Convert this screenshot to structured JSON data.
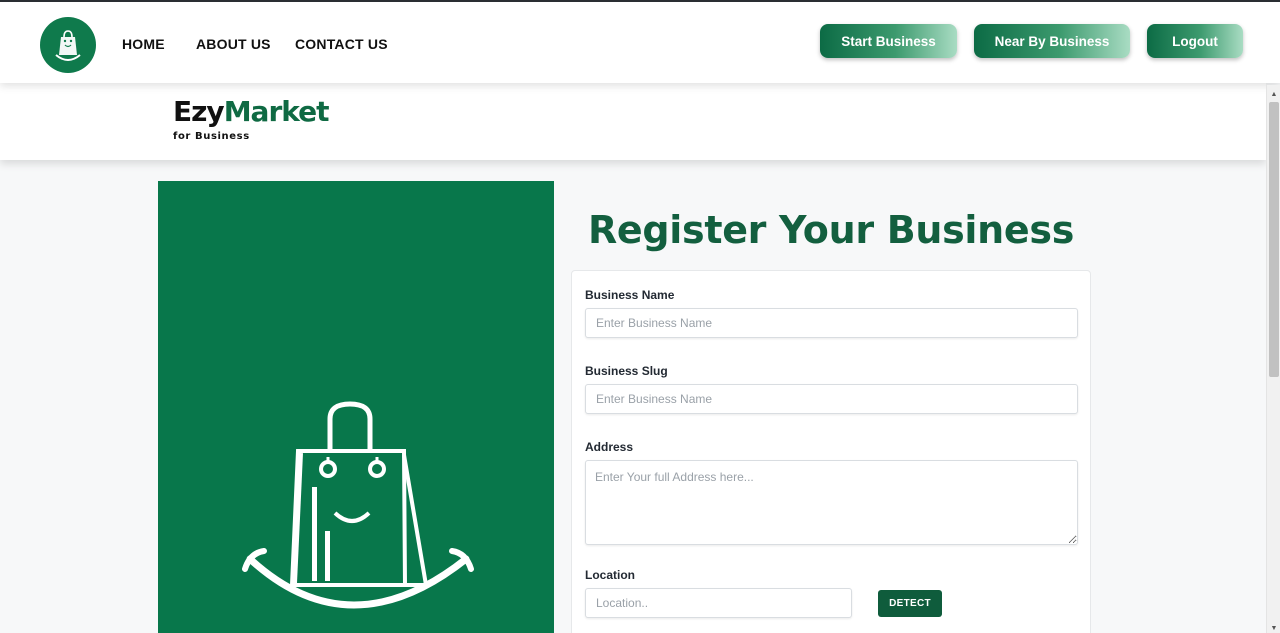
{
  "nav": {
    "links": [
      "HOME",
      "ABOUT US",
      "CONTACT US"
    ],
    "buttons": [
      "Start Business",
      "Near By Business",
      "Logout"
    ]
  },
  "brand": {
    "ezy": "Ezy",
    "market": "Market",
    "sub": "for Business"
  },
  "form": {
    "title": "Register Your Business",
    "business_name": {
      "label": "Business Name",
      "placeholder": "Enter Business Name"
    },
    "business_slug": {
      "label": "Business Slug",
      "placeholder": "Enter Business Name"
    },
    "address": {
      "label": "Address",
      "placeholder": "Enter Your full Address here..."
    },
    "location": {
      "label": "Location",
      "placeholder": "Location..",
      "detect_label": "DETECT"
    }
  },
  "colors": {
    "brand_green": "#08774b",
    "title_green": "#135f3f",
    "button_dark": "#0f5c3c"
  },
  "icons": {
    "logo": "shopping-bag-smile-icon",
    "panel_art": "shopping-bag-smile-icon"
  }
}
